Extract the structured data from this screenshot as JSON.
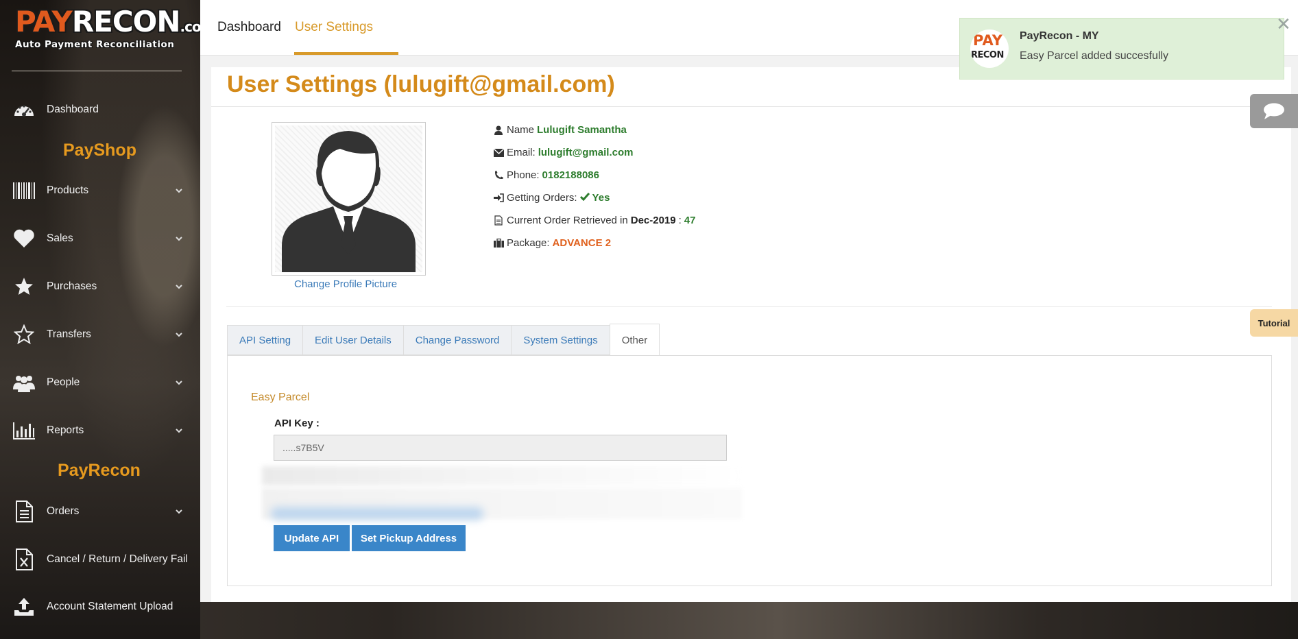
{
  "brand": {
    "logo_word": "PAYRECON",
    "logo_pay": "PAY",
    "logo_recon": "RECON",
    "logo_suffix": ".co",
    "tagline": "Auto Payment Reconciliation"
  },
  "sidebar": {
    "dashboard": "Dashboard",
    "section_payshop": "PayShop",
    "products": "Products",
    "sales": "Sales",
    "purchases": "Purchases",
    "transfers": "Transfers",
    "people": "People",
    "reports": "Reports",
    "section_payrecon": "PayRecon",
    "orders": "Orders",
    "cancel_return": "Cancel / Return / Delivery Fail",
    "account_statement": "Account Statement Upload"
  },
  "topnav": {
    "dashboard": "Dashboard",
    "user_settings": "User Settings"
  },
  "page": {
    "title": "User Settings (lulugift@gmail.com)"
  },
  "profile": {
    "change_picture": "Change Profile Picture",
    "name_label": "Name",
    "name_value": "Lulugift Samantha",
    "email_label": "Email:",
    "email_value": "lulugift@gmail.com",
    "phone_label": "Phone:",
    "phone_value": "0182188086",
    "orders_label": "Getting Orders:",
    "orders_value": "Yes",
    "retrieved_label": "Current Order Retrieved in",
    "retrieved_month": "Dec-2019",
    "retrieved_sep": ":",
    "retrieved_count": "47",
    "package_label": "Package:",
    "package_value": "ADVANCE 2"
  },
  "tabs": [
    "API Setting",
    "Edit User Details",
    "Change Password",
    "System Settings",
    "Other"
  ],
  "easy_parcel": {
    "title": "Easy Parcel",
    "api_key_label": "API Key :",
    "api_key_value": ".....s7B5V",
    "update_button": "Update API",
    "pickup_button": "Set Pickup Address"
  },
  "toast": {
    "title": "PayRecon - MY",
    "message": "Easy Parcel added succesfully",
    "close": "✕"
  },
  "floating": {
    "tutorial": "Tutorial"
  },
  "colors": {
    "accent": "#d48a1a",
    "link": "#3a7ab8",
    "button": "#3a86c9",
    "success_bg": "#dff0d8",
    "green": "#2e7d2e",
    "orange": "#e0611e"
  }
}
